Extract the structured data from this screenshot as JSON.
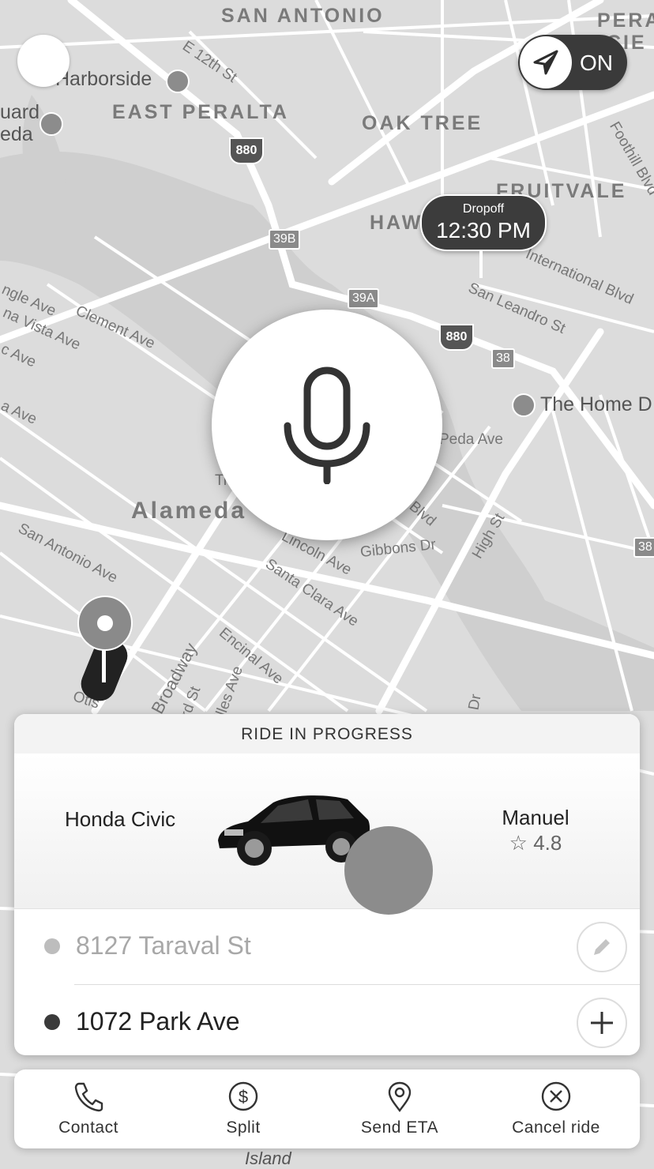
{
  "map": {
    "areas": [
      "SAN ANTONIO",
      "EAST PERALTA",
      "OAK TREE",
      "FRUITVALE",
      "HAW",
      "Alameda",
      "PERA",
      "CIE"
    ],
    "streets": [
      "E 12th St",
      "Clement Ave",
      "San Leandro St",
      "International Blvd",
      "Foothill Blvd",
      "Lincoln Ave",
      "Santa Clara Ave",
      "Encinal Ave",
      "Broadway",
      "Gibbons Dr",
      "High St",
      "San Antonio Ave",
      "Otis",
      "Peda Ave",
      "Blvd",
      "ngle Ave",
      "na Vista Ave",
      "c Ave",
      "a Ave",
      "Ti",
      "rd St",
      "illes Ave",
      "Dr",
      "Island"
    ],
    "pois": [
      "Harborside",
      "uard",
      "eda",
      "The Home D"
    ],
    "highway_shields": [
      "880",
      "880"
    ],
    "exit_shields": [
      "39B",
      "39A",
      "38",
      "38"
    ]
  },
  "controls": {
    "nav_toggle_label": "ON"
  },
  "dropoff": {
    "label": "Dropoff",
    "time": "12:30 PM"
  },
  "ride": {
    "status": "RIDE IN PROGRESS",
    "car_model": "Honda Civic",
    "driver_name": "Manuel",
    "driver_rating": "☆ 4.8",
    "pickup_address": "8127 Taraval St",
    "dropoff_address": "1072 Park Ave"
  },
  "actions": [
    {
      "label": "Contact",
      "icon": "phone-icon"
    },
    {
      "label": "Split",
      "icon": "dollar-icon"
    },
    {
      "label": "Send ETA",
      "icon": "location-pin-icon"
    },
    {
      "label": "Cancel ride",
      "icon": "cancel-icon"
    }
  ],
  "colors": {
    "map_bg": "#dcdcdc",
    "accent_dark": "#3c3c3c",
    "pickup_dot": "#bdbdbd",
    "dropoff_dot": "#3a3a3a"
  }
}
